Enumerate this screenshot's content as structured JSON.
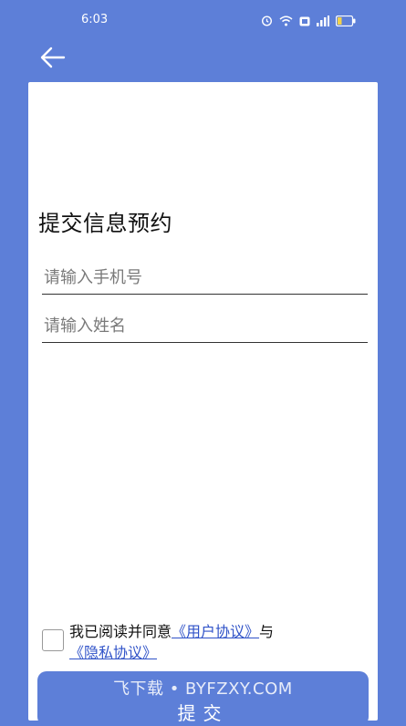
{
  "status_bar": {
    "time": "6:03",
    "battery": "20"
  },
  "header": {
    "back_icon": "arrow-left-icon"
  },
  "form": {
    "title": "提交信息预约",
    "phone_placeholder": "请输入手机号",
    "name_placeholder": "请输入姓名"
  },
  "agreement": {
    "prefix": "我已阅读并同意",
    "user_agreement": "《用户协议》",
    "connector": "与",
    "privacy_policy": "《隐私协议》"
  },
  "submit": {
    "label": "提交"
  },
  "watermark": "飞下载 • BYFZXY.COM",
  "colors": {
    "brand": "#5d7fd8",
    "link": "#2f52c8"
  }
}
